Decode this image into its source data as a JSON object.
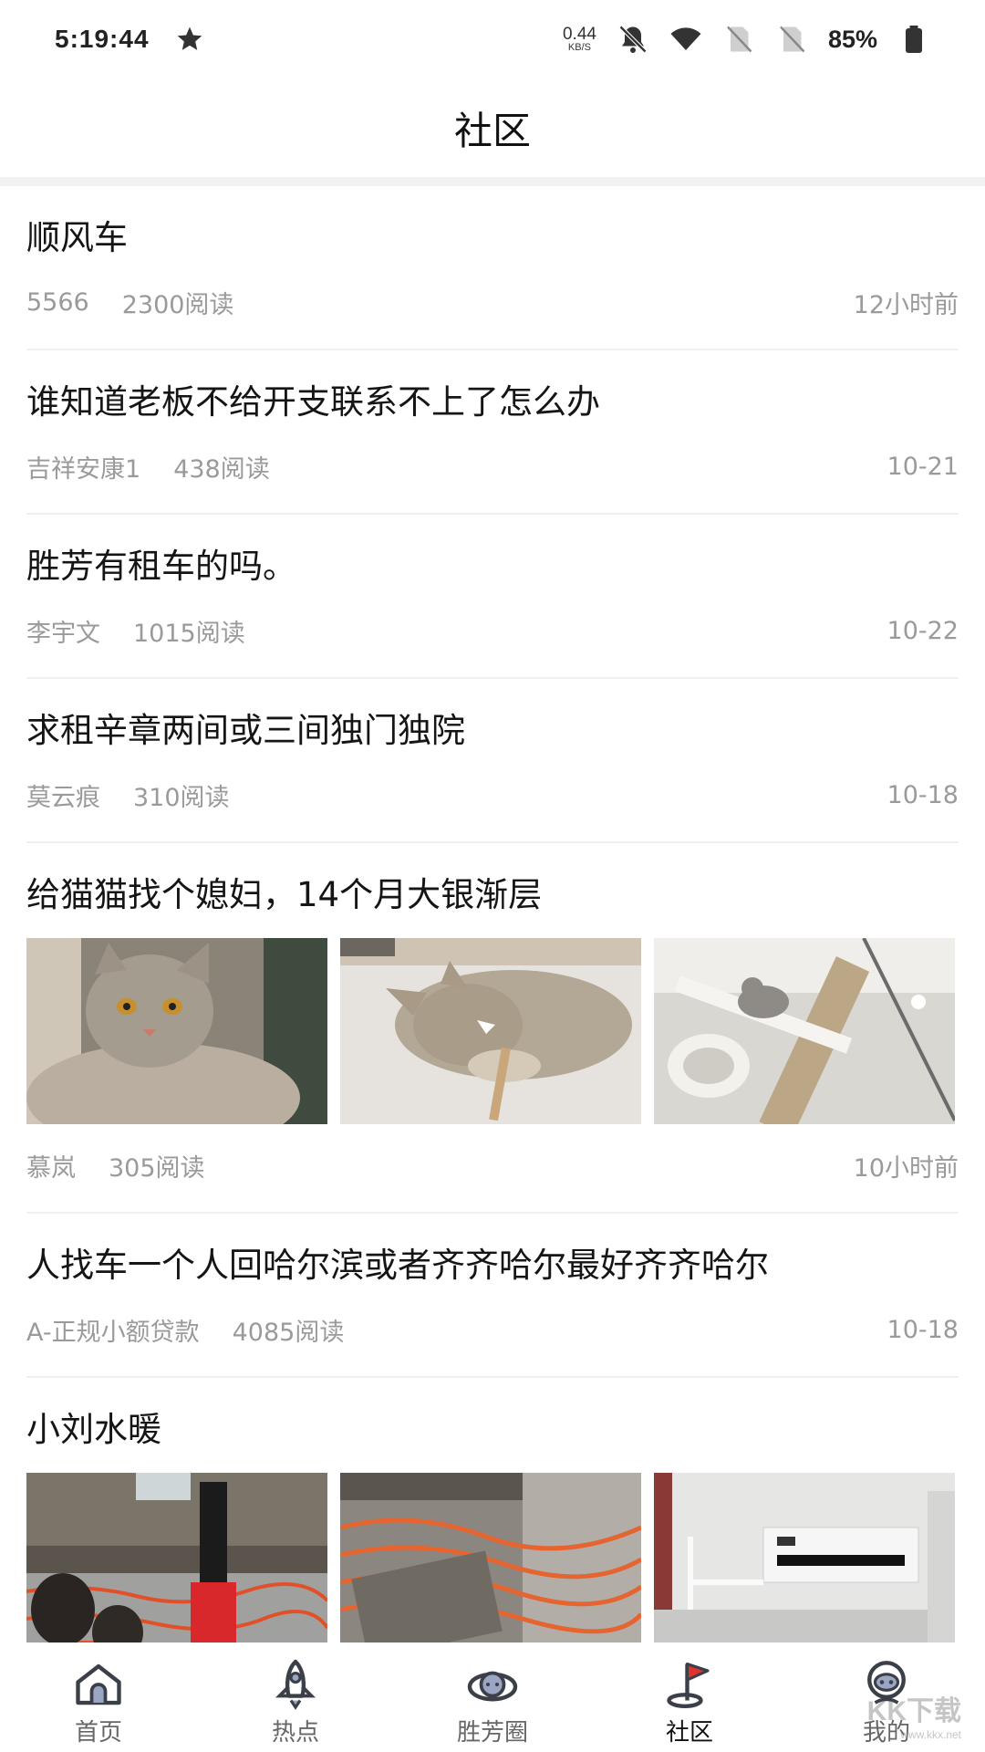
{
  "status_bar": {
    "time": "5:19:44",
    "net_speed_value": "0.44",
    "net_speed_unit": "KB/S",
    "battery": "85%"
  },
  "header": {
    "title": "社区"
  },
  "posts": [
    {
      "title": "顺风车",
      "author": "5566",
      "reads": "2300阅读",
      "time": "12小时前"
    },
    {
      "title": "谁知道老板不给开支联系不上了怎么办",
      "author": "吉祥安康1",
      "reads": "438阅读",
      "time": "10-21"
    },
    {
      "title": "胜芳有租车的吗。",
      "author": "李宇文",
      "reads": "1015阅读",
      "time": "10-22"
    },
    {
      "title": "求租辛章两间或三间独门独院",
      "author": "莫云痕",
      "reads": "310阅读",
      "time": "10-18"
    },
    {
      "title": "给猫猫找个媳妇，14个月大银渐层",
      "author": "慕岚",
      "reads": "305阅读",
      "time": "10小时前"
    },
    {
      "title": "人找车一个人回哈尔滨或者齐齐哈尔最好齐齐哈尔",
      "author": "A-正规小额贷款",
      "reads": "4085阅读",
      "time": "10-18"
    },
    {
      "title": "小刘水暖"
    }
  ],
  "bottom_nav": [
    {
      "label": "首页",
      "icon": "home-icon"
    },
    {
      "label": "热点",
      "icon": "rocket-icon"
    },
    {
      "label": "胜芳圈",
      "icon": "planet-icon"
    },
    {
      "label": "社区",
      "icon": "community-flag-icon",
      "active": true
    },
    {
      "label": "我的",
      "icon": "profile-icon"
    }
  ],
  "watermark": {
    "text": "KK下载",
    "url": "www.kkx.net"
  },
  "colors": {
    "meta_text": "#9a9a9a",
    "divider": "#f0f0f0",
    "nav_active": "#111111",
    "accent_red": "#e0322f"
  }
}
